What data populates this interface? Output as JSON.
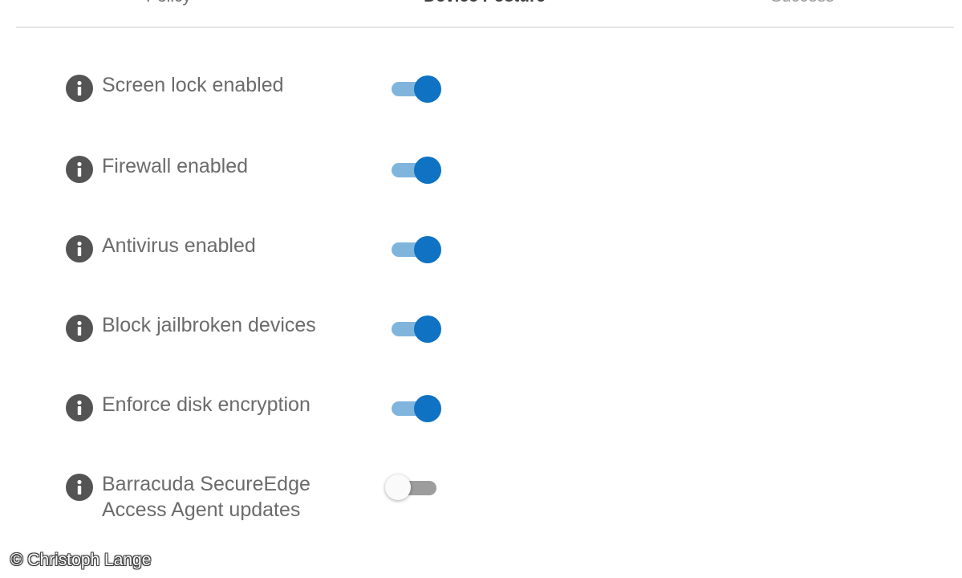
{
  "stepper": {
    "steps": [
      {
        "label": "Policy",
        "state": "completed"
      },
      {
        "label": "Device Posture",
        "state": "active"
      },
      {
        "label": "Success",
        "state": "upcoming"
      }
    ]
  },
  "settings": [
    {
      "label": "Screen lock enabled",
      "enabled": true
    },
    {
      "label": "Firewall enabled",
      "enabled": true
    },
    {
      "label": "Antivirus enabled",
      "enabled": true
    },
    {
      "label": "Block jailbroken devices",
      "enabled": true
    },
    {
      "label": "Enforce disk encryption",
      "enabled": true
    },
    {
      "label": "Barracuda SecureEdge Access Agent updates",
      "enabled": false
    }
  ],
  "icons": {
    "info": "info-icon"
  },
  "colors": {
    "toggle_on_knob": "#0f72c2",
    "toggle_on_track": "#7fb5dd",
    "toggle_off_knob": "#fafafa",
    "toggle_off_track": "#9d9d9d",
    "info_icon": "#545454"
  },
  "watermark": "© Christoph Lange"
}
